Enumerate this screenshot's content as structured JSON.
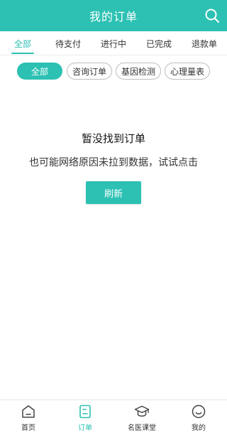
{
  "header": {
    "title": "我的订单",
    "search_icon": "search-icon"
  },
  "tabs": [
    {
      "label": "全部",
      "active": true
    },
    {
      "label": "待支付",
      "active": false
    },
    {
      "label": "进行中",
      "active": false
    },
    {
      "label": "已完成",
      "active": false
    },
    {
      "label": "退款单",
      "active": false
    }
  ],
  "filters": [
    {
      "label": "全部",
      "active": true
    },
    {
      "label": "咨询订单",
      "active": false
    },
    {
      "label": "基因检测",
      "active": false
    },
    {
      "label": "心理量表",
      "active": false
    }
  ],
  "empty": {
    "title": "暂没找到订单",
    "subtitle": "也可能网络原因未拉到数据，试试点击",
    "refresh_label": "刷新"
  },
  "bottom_nav": [
    {
      "label": "首页",
      "icon": "home-icon",
      "active": false
    },
    {
      "label": "订单",
      "icon": "order-icon",
      "active": true
    },
    {
      "label": "名医课堂",
      "icon": "graduation-cap-icon",
      "active": false
    },
    {
      "label": "我的",
      "icon": "profile-icon",
      "active": false
    }
  ],
  "colors": {
    "accent": "#2cc1b3",
    "text": "#333333",
    "chip_border": "#bdbdbd"
  }
}
